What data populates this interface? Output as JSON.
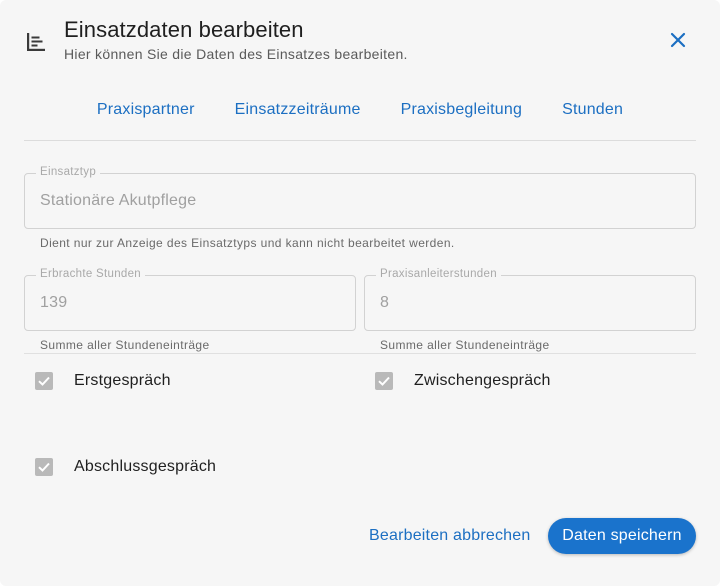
{
  "dialog": {
    "title": "Einsatzdaten bearbeiten",
    "subtitle": "Hier können Sie die Daten des Einsatzes bearbeiten.",
    "header_icon": "timeline-icon",
    "close_icon": "close-icon"
  },
  "tabs": [
    {
      "label": "Praxispartner"
    },
    {
      "label": "Einsatzzeiträume"
    },
    {
      "label": "Praxisbegleitung"
    },
    {
      "label": "Stunden"
    }
  ],
  "fields": {
    "einsatztyp": {
      "label": "Einsatztyp",
      "value": "Stationäre Akutpflege",
      "hint": "Dient nur zur Anzeige des Einsatztyps und kann nicht bearbeitet werden."
    },
    "erbrachte_stunden": {
      "label": "Erbrachte Stunden",
      "value": "139",
      "hint": "Summe aller Stundeneinträge"
    },
    "praxisanleiterstunden": {
      "label": "Praxisanleiterstunden",
      "value": "8",
      "hint": "Summe aller Stundeneinträge"
    }
  },
  "checkboxes": {
    "erstgespraech": {
      "label": "Erstgespräch",
      "checked": true
    },
    "zwischengespraech": {
      "label": "Zwischengespräch",
      "checked": true
    },
    "abschlussgespraech": {
      "label": "Abschlussgespräch",
      "checked": true
    }
  },
  "actions": {
    "cancel_label": "Bearbeiten abbrechen",
    "save_label": "Daten speichern"
  },
  "colors": {
    "accent": "#1c6fc2",
    "primary_button": "#1a73cc",
    "checkbox_disabled": "#b9b9b9"
  }
}
